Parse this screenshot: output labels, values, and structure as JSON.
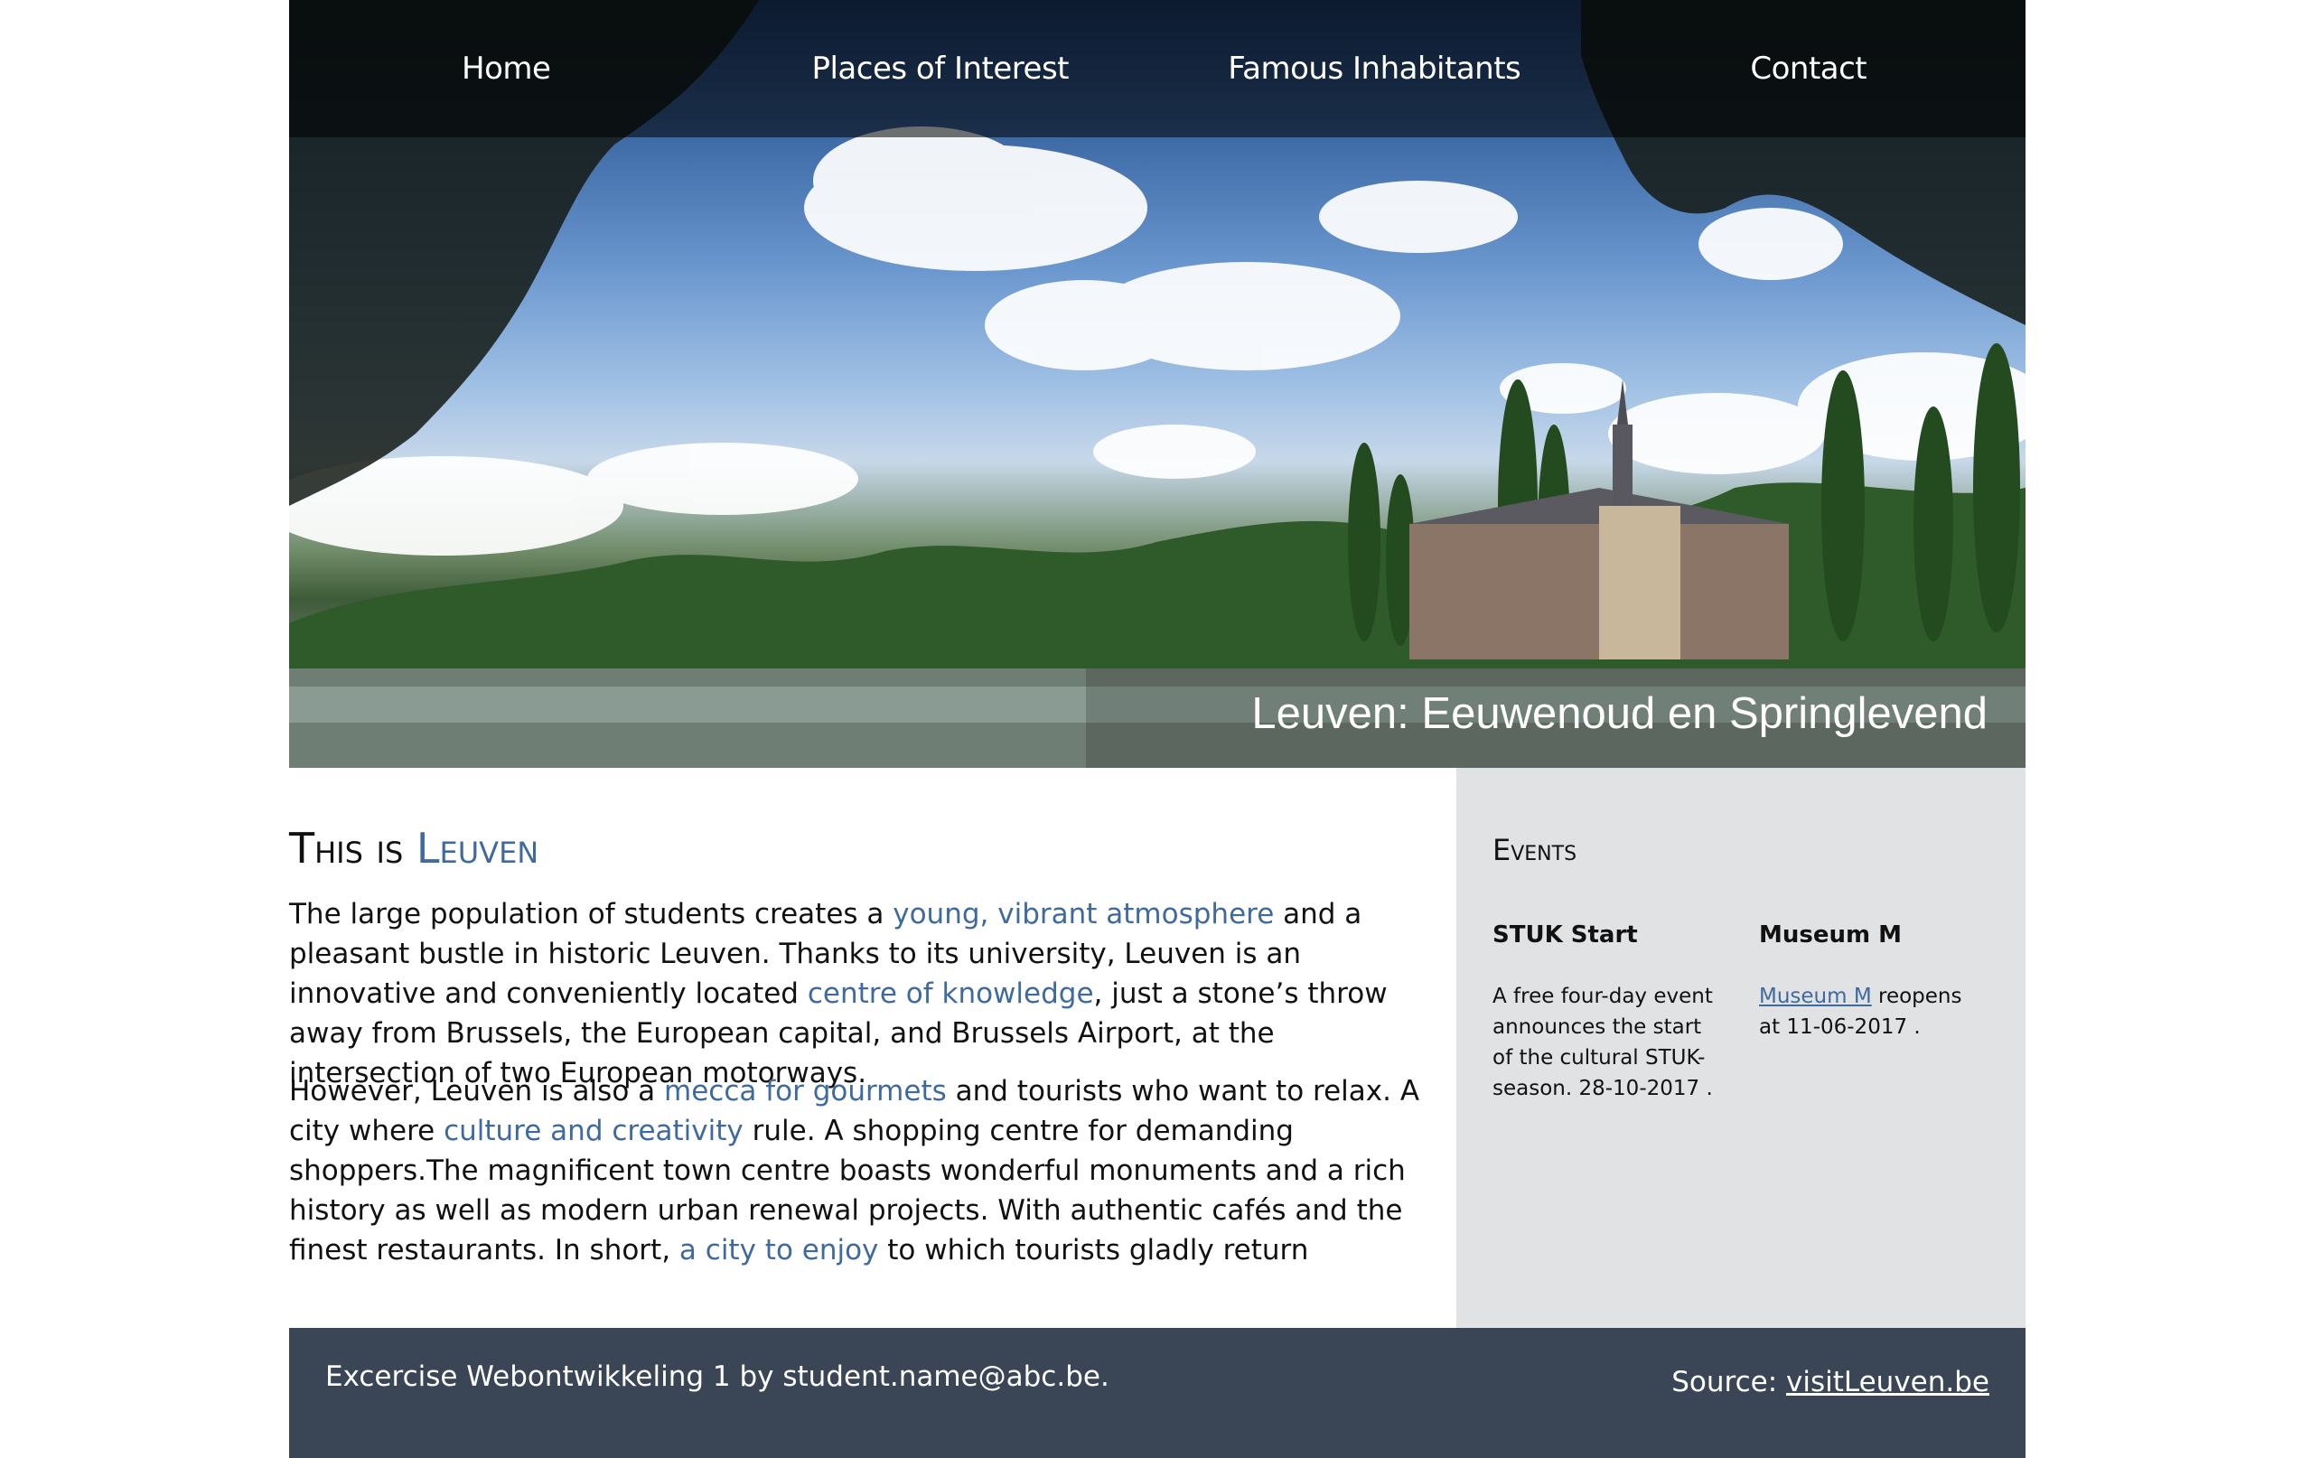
{
  "nav": {
    "items": [
      {
        "label": "Home"
      },
      {
        "label": "Places of Interest"
      },
      {
        "label": "Famous Inhabitants"
      },
      {
        "label": "Contact"
      }
    ]
  },
  "hero": {
    "caption": "Leuven: Eeuwenoud en Springlevend"
  },
  "main": {
    "heading_prefix": "This is ",
    "heading_city": "Leuven",
    "p1": {
      "t1": "The large population of students creates a ",
      "link1": "young, vibrant atmosphere",
      "t2": " and a pleasant bustle in historic Leuven. Thanks to its university, Leuven is an innovative and conveniently located ",
      "link2": "centre of knowledge",
      "t3": ", just a stone’s throw away from Brussels, the European capital, and Brussels Airport, at the intersection of two European motorways."
    },
    "p2": {
      "t1": "However, Leuven is also a ",
      "link1": "mecca for gourmets",
      "t2": " and tourists who want to relax. A city where ",
      "link2": "culture and creativity",
      "t3": " rule. A shopping centre for demanding shoppers.The magnificent town centre boasts wonderful monuments and a rich history as well as modern urban renewal projects. With authentic cafés and the finest restaurants. In short, ",
      "link3": "a city to enjoy",
      "t4": " to which tourists gladly return"
    }
  },
  "sidebar": {
    "title": "Events",
    "events": [
      {
        "title": "STUK Start",
        "text": "A free four-day event announces the start of the cultural STUK-season. 28-10-2017 ."
      },
      {
        "title": "Museum M",
        "link": "Museum M",
        "text": " reopens at 11-06-2017 ."
      }
    ]
  },
  "footer": {
    "left": "Excercise Webontwikkeling 1 by student.name@abc.be.",
    "source_label": "Source: ",
    "source_link": "visitLeuven.be"
  }
}
